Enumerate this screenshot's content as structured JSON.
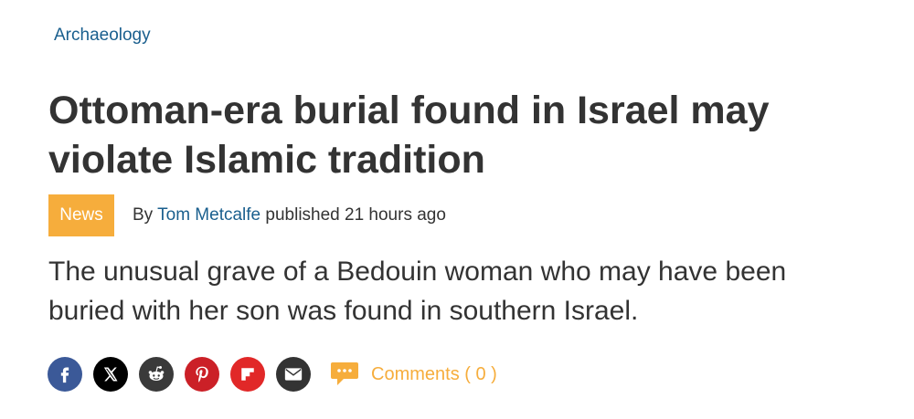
{
  "breadcrumb": {
    "label": "Archaeology"
  },
  "article": {
    "title_line1": "Ottoman-era burial found in Israel may",
    "title_line2": "violate Islamic tradition",
    "badge": "News",
    "byline_prefix": "By",
    "author": "Tom Metcalfe",
    "published": "published 21 hours ago",
    "summary_line1": "The unusual grave of a Bedouin woman who may have been",
    "summary_line2": "buried with her son was found in southern Israel."
  },
  "share": {
    "buttons": [
      {
        "name": "facebook-icon",
        "color": "#3b5998"
      },
      {
        "name": "x-icon",
        "color": "#000000"
      },
      {
        "name": "reddit-icon",
        "color": "#3a3a3a"
      },
      {
        "name": "pinterest-icon",
        "color": "#cb2027"
      },
      {
        "name": "flipboard-icon",
        "color": "#e12828"
      },
      {
        "name": "email-icon",
        "color": "#333333"
      }
    ],
    "comments_label": "Comments ( 0 )",
    "comments_color": "#f6ad3c"
  },
  "colors": {
    "link": "#1a5f8e",
    "badge": "#f6ad3c",
    "text": "#333333"
  }
}
